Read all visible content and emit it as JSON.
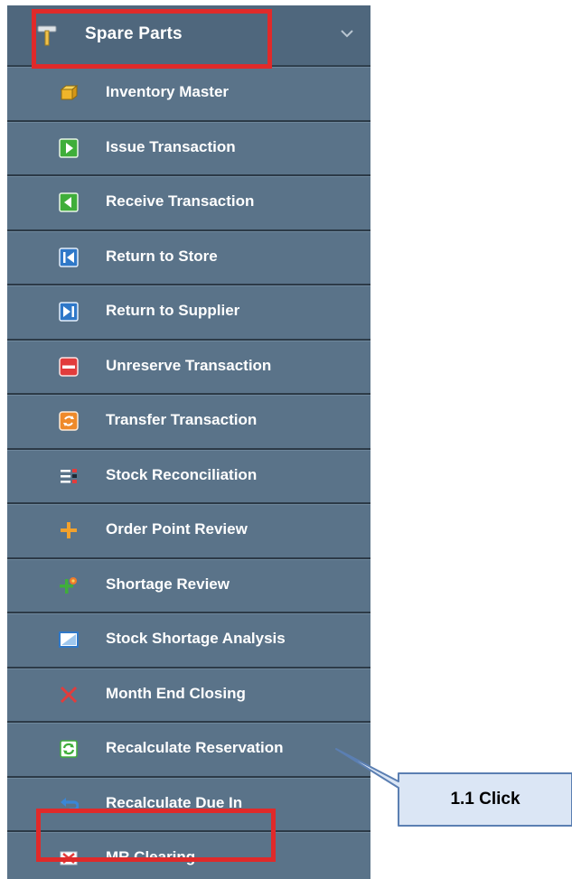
{
  "menu": {
    "header": {
      "label": "Spare Parts",
      "icon": "hammer-icon",
      "toggle_icon": "chevron-down-icon"
    },
    "items": [
      {
        "label": "Inventory Master",
        "icon": "box-icon"
      },
      {
        "label": "Issue Transaction",
        "icon": "arrow-right-green-icon"
      },
      {
        "label": "Receive Transaction",
        "icon": "arrow-left-green-icon"
      },
      {
        "label": "Return to Store",
        "icon": "skip-back-blue-icon"
      },
      {
        "label": "Return to Supplier",
        "icon": "skip-forward-blue-icon"
      },
      {
        "label": "Unreserve Transaction",
        "icon": "minus-red-icon"
      },
      {
        "label": "Transfer Transaction",
        "icon": "transfer-orange-icon"
      },
      {
        "label": "Stock Reconciliation",
        "icon": "reconcile-icon"
      },
      {
        "label": "Order Point Review",
        "icon": "plus-orange-icon"
      },
      {
        "label": "Shortage Review",
        "icon": "shortage-icon"
      },
      {
        "label": "Stock Shortage Analysis",
        "icon": "window-icon"
      },
      {
        "label": "Month End Closing",
        "icon": "close-x-icon"
      },
      {
        "label": "Recalculate Reservation",
        "icon": "recalc-green-icon"
      },
      {
        "label": "Recalculate Due In",
        "icon": "undo-arrow-icon"
      },
      {
        "label": "MR Clearing",
        "icon": "clear-icon"
      }
    ]
  },
  "callout": {
    "label": "1.1 Click"
  },
  "colors": {
    "menu_bg": "#5a7389",
    "header_bg": "#4f677d",
    "highlight": "#e02a2a",
    "callout_bg": "#dbe6f5",
    "callout_border": "#5b7fb2"
  }
}
